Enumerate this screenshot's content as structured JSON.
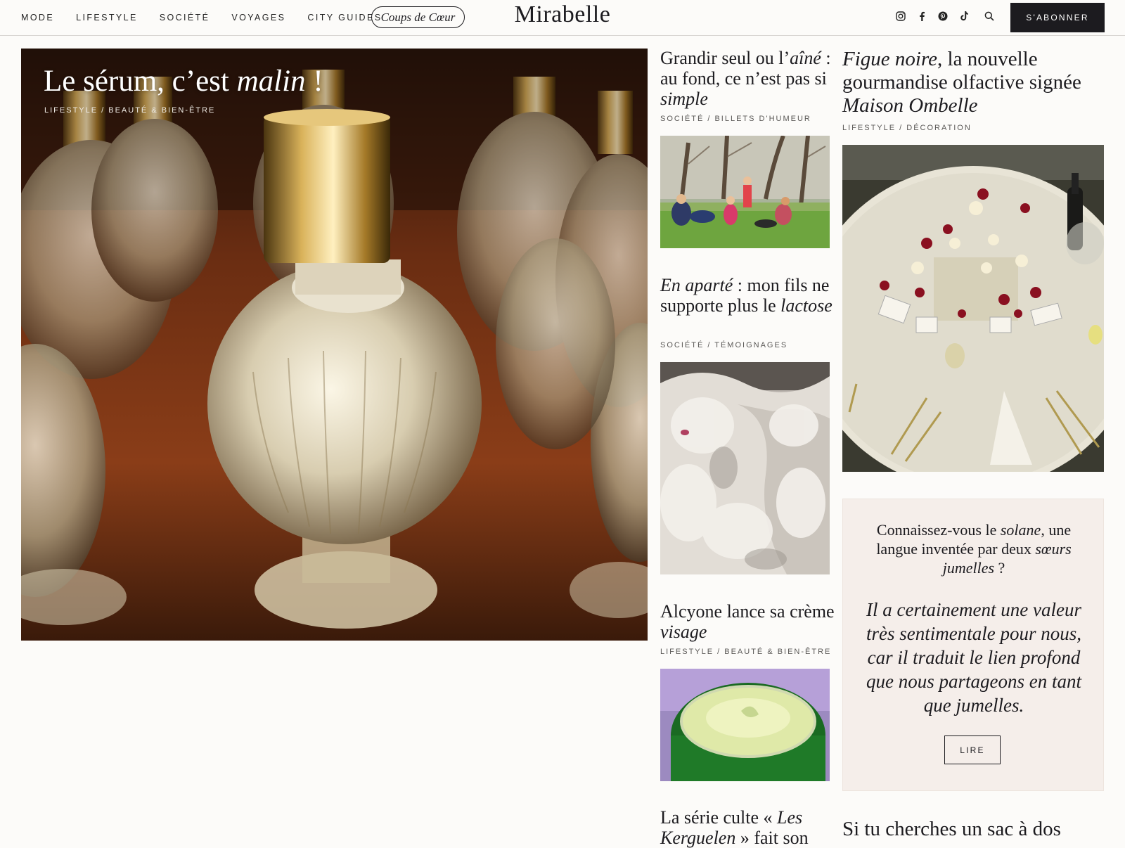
{
  "header": {
    "nav": [
      "MODE",
      "LIFESTYLE",
      "SOCIÉTÉ",
      "VOYAGES",
      "CITY GUIDES"
    ],
    "pill": "Coups de Cœur",
    "logo": "Mirabelle",
    "social_icons": [
      "instagram-icon",
      "facebook-icon",
      "pinterest-icon",
      "tiktok-icon",
      "search-icon"
    ],
    "subscribe": "S'ABONNER"
  },
  "hero": {
    "title_pre": "Le sérum, c’est ",
    "title_em": "malin",
    "title_post": " !",
    "category": "LIFESTYLE / BEAUTÉ & BIEN-ÊTRE"
  },
  "col2": [
    {
      "t1": "Grandir seul ou l’",
      "em1": "aîné",
      "t2": " : au fond, ce n’est pas si ",
      "em2": "simple",
      "t3": "",
      "category": "SOCIÉTÉ / BILLETS D'HUMEUR"
    },
    {
      "t1": "",
      "em1": "En aparté",
      "t2": " : mon fils ne supporte plus le ",
      "em2": "lactose",
      "t3": "",
      "category": "SOCIÉTÉ / TÉMOIGNAGES"
    },
    {
      "t1": "Alcyone lance sa crème ",
      "em1": "visage",
      "t2": "",
      "em2": "",
      "t3": "",
      "category": "LIFESTYLE / BEAUTÉ & BIEN-ÊTRE"
    },
    {
      "t1": "La série culte « ",
      "em1": "Les Kerguelen",
      "t2": " » fait son",
      "em2": "",
      "t3": ""
    }
  ],
  "col3": {
    "article1": {
      "em1": "Figue noire",
      "t1": ", la nouvelle gourmandise olfactive signée ",
      "em2": "Maison Ombelle",
      "category": "LIFESTYLE / DÉCORATION"
    },
    "quote_box": {
      "q_pre": "Connaissez-vous le ",
      "q_em1": "solane",
      "q_mid": ", une langue inventée par deux ",
      "q_em2": "sœurs jumelles",
      "q_post": " ?",
      "quote": "Il a certainement une valeur très sentimentale pour nous, car il traduit le lien profond que nous partageons en tant que jumelles.",
      "button": "LIRE"
    },
    "article2": {
      "title": "Si tu cherches un sac à dos"
    }
  }
}
